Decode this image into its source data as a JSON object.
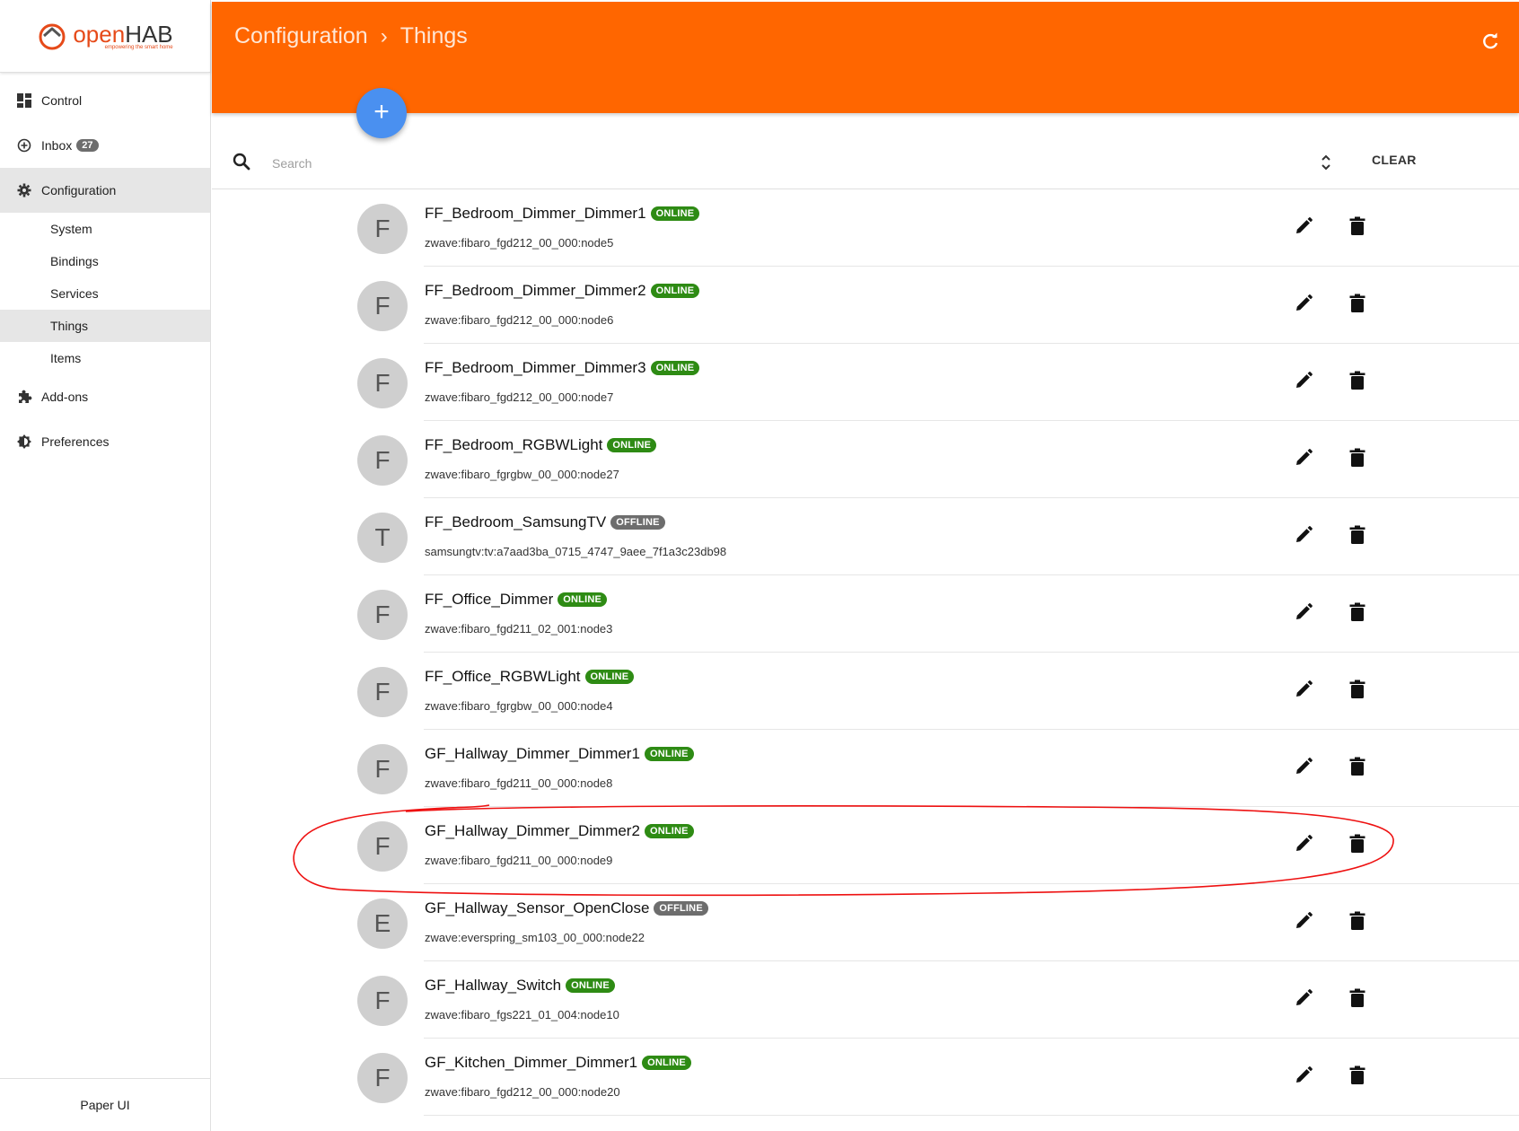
{
  "logo": {
    "text_open": "open",
    "text_hab": "HAB",
    "tagline": "empowering the smart home"
  },
  "sidebar": {
    "items": [
      {
        "label": "Control",
        "icon": "dashboard-icon"
      },
      {
        "label": "Inbox",
        "icon": "add-circle-icon",
        "badge": "27"
      },
      {
        "label": "Configuration",
        "icon": "gear-icon"
      }
    ],
    "sub_items": [
      "System",
      "Bindings",
      "Services",
      "Things",
      "Items"
    ],
    "bottom_items": [
      {
        "label": "Add-ons",
        "icon": "puzzle-icon"
      },
      {
        "label": "Preferences",
        "icon": "brightness-icon"
      }
    ],
    "footer": "Paper UI"
  },
  "header": {
    "crumb1": "Configuration",
    "separator": "›",
    "crumb2": "Things",
    "accent": "#ff6600"
  },
  "fab": {
    "label": "+"
  },
  "search": {
    "placeholder": "Search",
    "clear_label": "CLEAR"
  },
  "things": [
    {
      "letter": "F",
      "name": "FF_Bedroom_Dimmer_Dimmer1",
      "status": "ONLINE",
      "uid": "zwave:fibaro_fgd212_00_000:node5"
    },
    {
      "letter": "F",
      "name": "FF_Bedroom_Dimmer_Dimmer2",
      "status": "ONLINE",
      "uid": "zwave:fibaro_fgd212_00_000:node6"
    },
    {
      "letter": "F",
      "name": "FF_Bedroom_Dimmer_Dimmer3",
      "status": "ONLINE",
      "uid": "zwave:fibaro_fgd212_00_000:node7"
    },
    {
      "letter": "F",
      "name": "FF_Bedroom_RGBWLight",
      "status": "ONLINE",
      "uid": "zwave:fibaro_fgrgbw_00_000:node27"
    },
    {
      "letter": "T",
      "name": "FF_Bedroom_SamsungTV",
      "status": "OFFLINE",
      "uid": "samsungtv:tv:a7aad3ba_0715_4747_9aee_7f1a3c23db98"
    },
    {
      "letter": "F",
      "name": "FF_Office_Dimmer",
      "status": "ONLINE",
      "uid": "zwave:fibaro_fgd211_02_001:node3"
    },
    {
      "letter": "F",
      "name": "FF_Office_RGBWLight",
      "status": "ONLINE",
      "uid": "zwave:fibaro_fgrgbw_00_000:node4"
    },
    {
      "letter": "F",
      "name": "GF_Hallway_Dimmer_Dimmer1",
      "status": "ONLINE",
      "uid": "zwave:fibaro_fgd211_00_000:node8"
    },
    {
      "letter": "F",
      "name": "GF_Hallway_Dimmer_Dimmer2",
      "status": "ONLINE",
      "uid": "zwave:fibaro_fgd211_00_000:node9"
    },
    {
      "letter": "E",
      "name": "GF_Hallway_Sensor_OpenClose",
      "status": "OFFLINE",
      "uid": "zwave:everspring_sm103_00_000:node22"
    },
    {
      "letter": "F",
      "name": "GF_Hallway_Switch",
      "status": "ONLINE",
      "uid": "zwave:fibaro_fgs221_01_004:node10"
    },
    {
      "letter": "F",
      "name": "GF_Kitchen_Dimmer_Dimmer1",
      "status": "ONLINE",
      "uid": "zwave:fibaro_fgd212_00_000:node20"
    }
  ]
}
